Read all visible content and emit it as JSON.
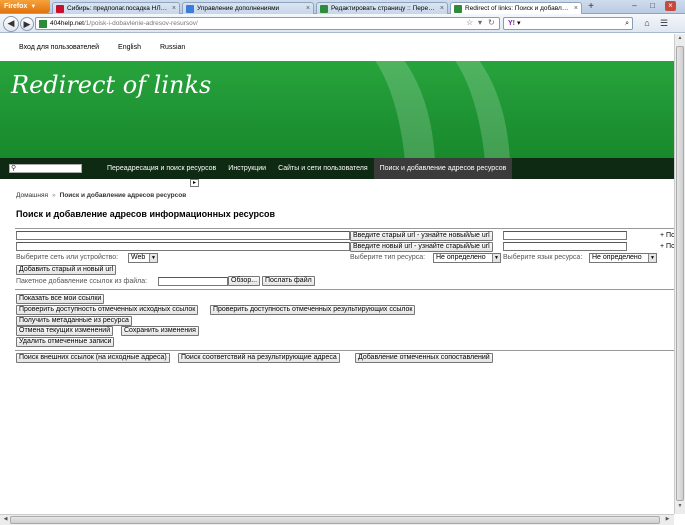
{
  "browser": {
    "app_button": "Firefox",
    "tabs": [
      {
        "label": "Сибирь: предполаг.посадка НЛО в Ус...",
        "favicon_color": "#c8102e"
      },
      {
        "label": "Управление дополнениями",
        "favicon_color": "#3b7ddd"
      },
      {
        "label": "Редактировать страницу :: Переадрес...",
        "favicon_color": "#2e8b3a"
      },
      {
        "label": "Redirect of links: Поиск и добавление ад...",
        "favicon_color": "#2e8b3a"
      }
    ],
    "new_tab": "+",
    "url_domain": "404help.net",
    "url_path": "/1/poisk-i-dobavlenie-adresov-resursov/",
    "search_engine_icon": "Y!",
    "search_arrow": "▾"
  },
  "page": {
    "userbar": [
      "Вход для пользователей",
      "English",
      "Russian"
    ],
    "banner_title": "Redirect of links",
    "menu": [
      "Переадресация и поиск ресурсов",
      "Инструкции",
      "Сайты и сети пользователя",
      "Поиск и добавление адресов ресурсов"
    ],
    "menu_active_index": 3,
    "breadcrumb": {
      "home": "Домашняя",
      "separator": "»",
      "current": "Поиск и добавление адресов ресурсов"
    },
    "heading": "Поиск и добавление адресов информационных ресурсов",
    "form": {
      "old_url_button": "Введите старый url - узнайте новый/ые url",
      "new_url_button": "Введите новый url - узнайте старый/ые url",
      "plus_link_1": "+ По",
      "plus_link_2": "+ По",
      "network_label": "Выберите сеть или устройство:",
      "network_value": "Web",
      "resource_type_label": "Выберите тип ресурса:",
      "resource_type_value": "Не определено",
      "resource_lang_label": "Выберите язык ресурса:",
      "resource_lang_value": "Не определено",
      "add_button": "Добавить старый и новый url",
      "batch_label": "Пакетное добавление ссылок из файла:",
      "browse_button": "Обзор...",
      "send_file_button": "Послать файл",
      "show_all_button": "Показать все мои ссылки",
      "check_source_button": "Проверить доступность отмеченных исходных ссылок",
      "check_result_button": "Проверить доступность отмеченных результирующих ссылок",
      "metadata_button": "Получить метаданные из ресурса",
      "cancel_button": "Отмена текущих изменений",
      "save_button": "Сохранить изменения",
      "delete_button": "Удалить отмеченные записи",
      "search_external_button": "Поиск внешних ссылок (на исходные адреса)",
      "search_matches_button": "Поиск соответствий на результирующие адреса",
      "add_matches_button": "Добавление отмеченных сопоставлений"
    }
  },
  "colors": {
    "banner_green": "#1f9434",
    "menu_dark": "#0e2a12",
    "menu_active": "#3b3b3b"
  }
}
